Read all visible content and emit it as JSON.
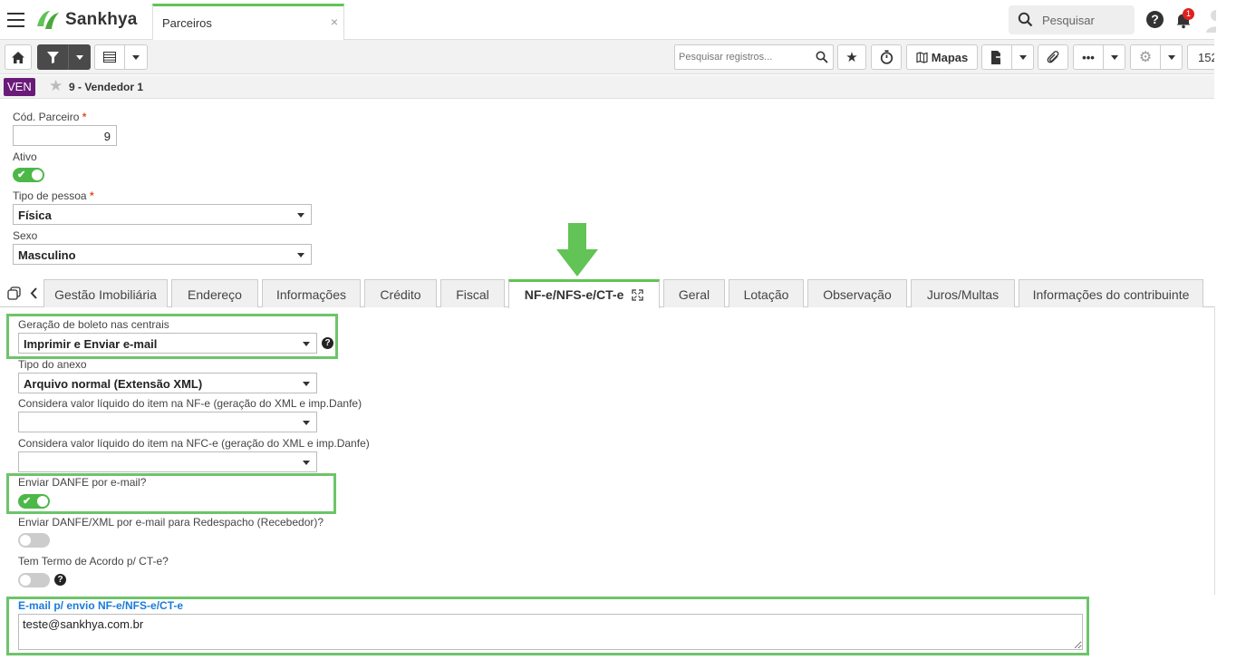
{
  "app": {
    "brand": "Sankhya",
    "brand_color": "#62c356"
  },
  "topbar": {
    "tab_label": "Parceiros",
    "tab_close": "×",
    "search_label": "Pesquisar",
    "help": "?",
    "notifications_count": "1"
  },
  "toolbar": {
    "search_placeholder": "Pesquisar registros...",
    "mapas_label": "Mapas",
    "pager_value": "152"
  },
  "record": {
    "badge": "VEN",
    "title": "9 - Vendedor 1"
  },
  "form": {
    "cod_parceiro_label": "Cód. Parceiro",
    "cod_parceiro_value": "9",
    "ativo_label": "Ativo",
    "ativo_on": true,
    "tipo_pessoa_label": "Tipo de pessoa",
    "tipo_pessoa_value": "Física",
    "sexo_label": "Sexo",
    "sexo_value": "Masculino",
    "required_mark": "*"
  },
  "tabs": [
    "Gestão Imobiliária",
    "Endereço",
    "Informações",
    "Crédito",
    "Fiscal",
    "NF-e/NFS-e/CT-e",
    "Geral",
    "Lotação",
    "Observação",
    "Juros/Multas",
    "Informações do contribuinte"
  ],
  "nfe": {
    "geracao_label": "Geração de boleto nas centrais",
    "geracao_value": "Imprimir e Enviar e-mail",
    "tipo_anexo_label": "Tipo do anexo",
    "tipo_anexo_value": "Arquivo normal (Extensão XML)",
    "liquido_nfe_label": "Considera valor líquido do item na NF-e (geração do XML e imp.Danfe)",
    "liquido_nfe_value": "",
    "liquido_nfce_label": "Considera valor líquido do item na NFC-e (geração do XML e imp.Danfe)",
    "liquido_nfce_value": "",
    "enviar_danfe_label": "Enviar DANFE por e-mail?",
    "enviar_danfe_on": true,
    "redespacho_label": "Enviar DANFE/XML por e-mail para Redespacho (Recebedor)?",
    "redespacho_on": false,
    "termo_label": "Tem Termo de Acordo p/ CT-e?",
    "termo_on": false,
    "email_label": "E-mail p/ envio NF-e/NFS-e/CT-e",
    "email_value": "teste@sankhya.com.br"
  }
}
